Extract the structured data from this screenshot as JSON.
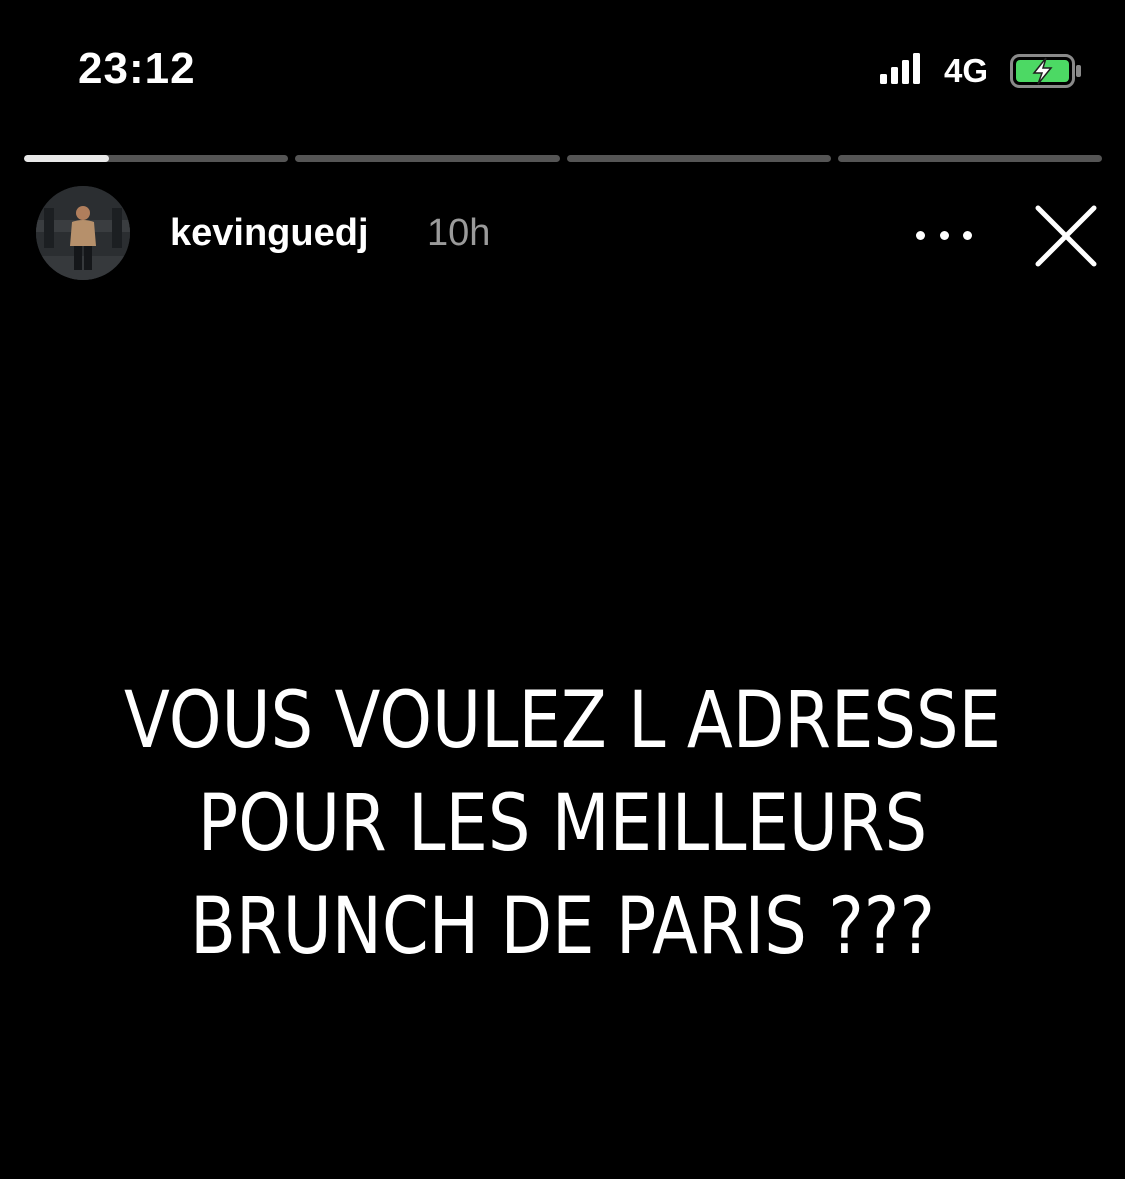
{
  "status_bar": {
    "time": "23:12",
    "network": "4G",
    "signal_icon": "cellular-signal-icon",
    "battery_icon": "battery-charging-icon",
    "battery_color": "#4cd964"
  },
  "story": {
    "segment_progress": [
      0.32,
      0,
      0,
      0
    ],
    "username": "kevinguedj",
    "time_ago": "10h",
    "more_icon": "more-horizontal-icon",
    "close_icon": "close-icon",
    "lines": [
      "VOUS VOULEZ L ADRESSE",
      "POUR LES MEILLEURS",
      "BRUNCH DE PARIS ???"
    ]
  }
}
